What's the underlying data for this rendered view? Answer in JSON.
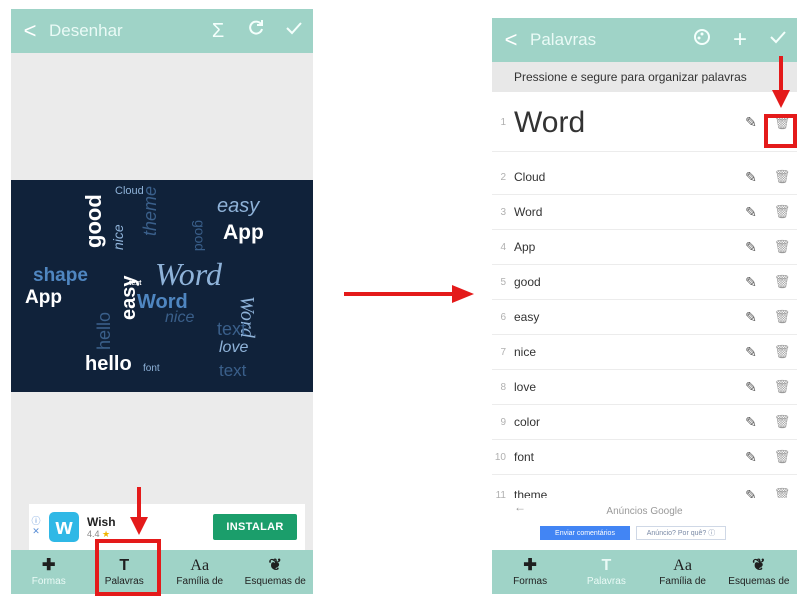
{
  "left_screen": {
    "title": "Desenhar",
    "back_glyph": "<",
    "icons": [
      "sum-icon",
      "refresh-icon",
      "check-icon"
    ],
    "word_cloud": [
      {
        "text": "good",
        "cls": "cw"
      },
      {
        "text": "App",
        "cls": "cw"
      },
      {
        "text": "shape",
        "cls": "cb"
      },
      {
        "text": "App",
        "cls": "cw"
      },
      {
        "text": "Word",
        "cls": "cl"
      },
      {
        "text": "Word",
        "cls": "cb"
      },
      {
        "text": "easy",
        "cls": "cl"
      },
      {
        "text": "nice",
        "cls": "cl"
      },
      {
        "text": "hello",
        "cls": "cw"
      },
      {
        "text": "text",
        "cls": "cd"
      },
      {
        "text": "love",
        "cls": "cl"
      },
      {
        "text": "Cloud",
        "cls": "cl"
      },
      {
        "text": "theme",
        "cls": "cd"
      },
      {
        "text": "Word",
        "cls": "cl"
      },
      {
        "text": "hello",
        "cls": "cd"
      },
      {
        "text": "text",
        "cls": "cd"
      },
      {
        "text": "easy",
        "cls": "cl"
      },
      {
        "text": "nice",
        "cls": "cd"
      },
      {
        "text": "good",
        "cls": "cd"
      },
      {
        "text": "font",
        "cls": "cl"
      },
      {
        "text": "text",
        "cls": "cw"
      }
    ],
    "ad": {
      "name": "Wish",
      "rating": "4.4",
      "star": "★",
      "logo_letter": "w",
      "install_label": "INSTALAR"
    },
    "nav": [
      {
        "icon": "✚",
        "label": "Formas"
      },
      {
        "icon": "T",
        "label": "Palavras"
      },
      {
        "icon": "Aa",
        "label": "Família de"
      },
      {
        "icon": "❦",
        "label": "Esquemas de"
      }
    ]
  },
  "right_screen": {
    "title": "Palavras",
    "back_glyph": "<",
    "icons": [
      "palette-icon",
      "plus-icon",
      "check-icon"
    ],
    "hint": "Pressione e segure para organizar palavras",
    "words": [
      {
        "num": "1",
        "text": "Word"
      },
      {
        "num": "2",
        "text": "Cloud"
      },
      {
        "num": "3",
        "text": "Word"
      },
      {
        "num": "4",
        "text": "App"
      },
      {
        "num": "5",
        "text": "good"
      },
      {
        "num": "6",
        "text": "easy"
      },
      {
        "num": "7",
        "text": "nice"
      },
      {
        "num": "8",
        "text": "love"
      },
      {
        "num": "9",
        "text": "color"
      },
      {
        "num": "10",
        "text": "font"
      },
      {
        "num": "11",
        "text": "theme"
      }
    ],
    "google_ads": {
      "title": "Anúncios Google",
      "feedback": "Enviar comentários",
      "why": "Anúncio? Por quê? ⓘ"
    },
    "nav": [
      {
        "icon": "✚",
        "label": "Formas"
      },
      {
        "icon": "T",
        "label": "Palavras"
      },
      {
        "icon": "Aa",
        "label": "Família de"
      },
      {
        "icon": "❦",
        "label": "Esquemas de"
      }
    ]
  },
  "colors": {
    "toolbar": "#9fd3c7",
    "highlight_red": "#e41a1a",
    "canvas_bg": "#10223a",
    "install_green": "#1b9e6b"
  }
}
